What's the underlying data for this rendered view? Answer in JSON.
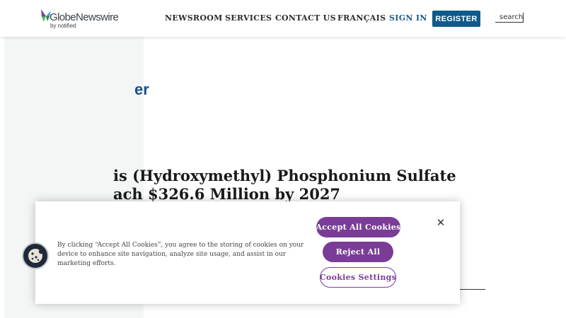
{
  "header": {
    "logo_text": "GlobeNewswire",
    "logo_sub": "by notified",
    "nav": {
      "newsroom": "NEWSROOM",
      "services": "SERVICES",
      "contact": "CONTACT US",
      "language": "FRANÇAIS",
      "signin": "SIGN IN",
      "register": "REGISTER"
    },
    "search_label": "search"
  },
  "page": {
    "brand_partial": "er",
    "headline_line1": "is (Hydroxymethyl) Phosphonium Sulfate",
    "headline_line2": "ach $326.6 Million by 2027"
  },
  "cookie_banner": {
    "message": "By clicking “Accept All Cookies”, you agree to the storing of cookies on your device to enhance site navigation, analyze site usage, and assist in our marketing efforts.",
    "accept_label": "Accept All Cookies",
    "reject_label": "Reject All",
    "settings_label": "Cookies Settings",
    "close_glyph": "✕"
  },
  "colors": {
    "accent_purple": "#7a3c97",
    "register_blue": "#0f5a8a",
    "signin_blue": "#1d5a8c",
    "brand_blue": "#1d4f8b"
  },
  "icons": {
    "logo": "globenewswire-butterfly-icon",
    "cookie_fab": "cookie-icon",
    "close": "close-icon"
  }
}
